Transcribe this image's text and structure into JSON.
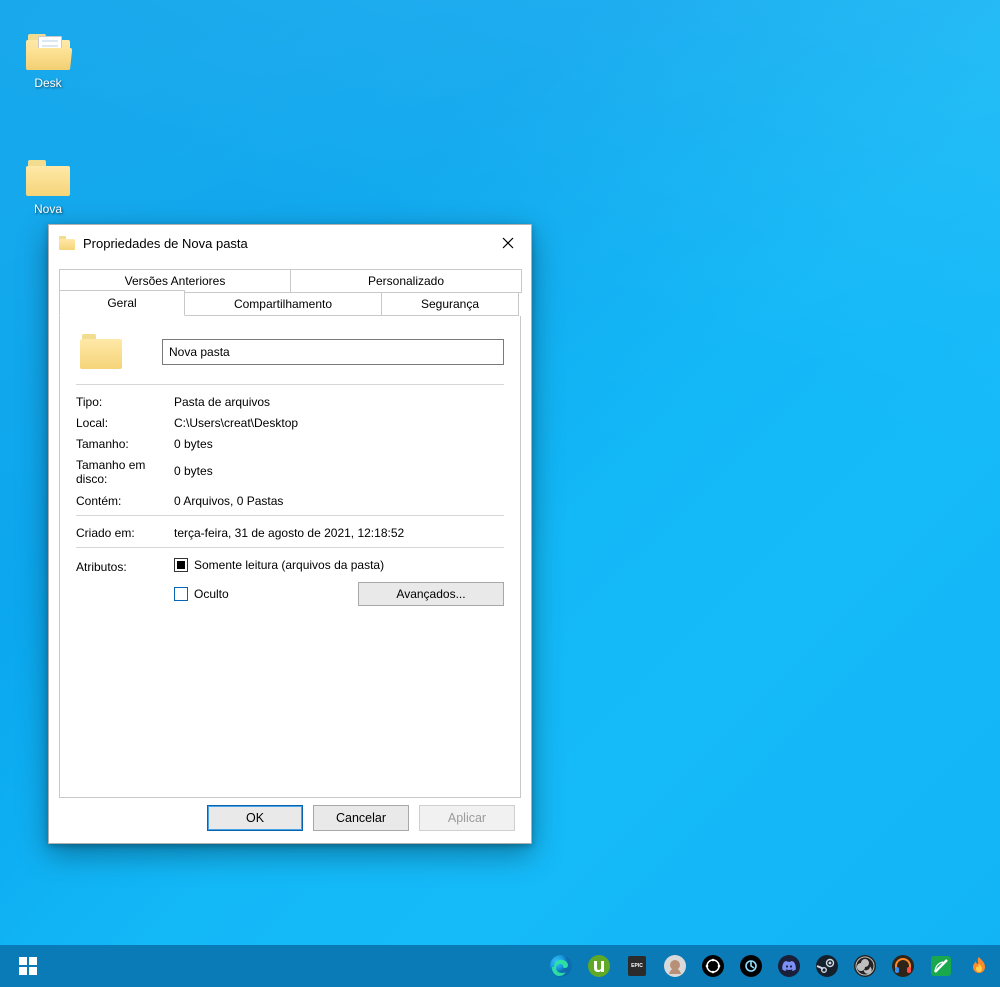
{
  "desktop": {
    "icons": [
      {
        "label": "Desk"
      },
      {
        "label": "Nova"
      }
    ]
  },
  "dialog": {
    "title": "Propriedades de Nova pasta",
    "tabs": {
      "versoes_anteriores": "Versões Anteriores",
      "personalizado": "Personalizado",
      "geral": "Geral",
      "compartilhamento": "Compartilhamento",
      "seguranca": "Segurança"
    },
    "name_value": "Nova pasta",
    "fields": {
      "tipo": {
        "label": "Tipo:",
        "value": "Pasta de arquivos"
      },
      "local": {
        "label": "Local:",
        "value": "C:\\Users\\creat\\Desktop"
      },
      "tamanho": {
        "label": "Tamanho:",
        "value": "0 bytes"
      },
      "tamanho_disco": {
        "label": "Tamanho em disco:",
        "value": "0 bytes"
      },
      "contem": {
        "label": "Contém:",
        "value": "0 Arquivos, 0 Pastas"
      },
      "criado_em": {
        "label": "Criado em:",
        "value": "terça-feira, 31 de agosto de 2021, 12:18:52"
      }
    },
    "attributes": {
      "label": "Atributos:",
      "readonly": "Somente leitura (arquivos da pasta)",
      "hidden": "Oculto",
      "advanced": "Avançados..."
    },
    "buttons": {
      "ok": "OK",
      "cancel": "Cancelar",
      "apply": "Aplicar"
    }
  }
}
